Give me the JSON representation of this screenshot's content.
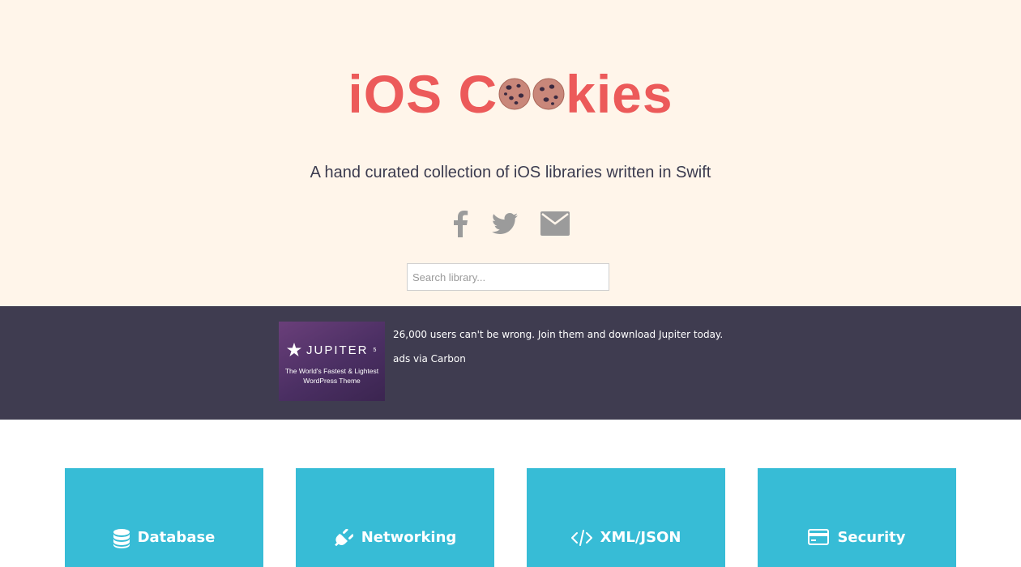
{
  "header": {
    "logo": {
      "part1": "iOS C",
      "part2": "kies"
    },
    "tagline": "A hand curated collection of iOS libraries written in Swift",
    "social": [
      {
        "name": "facebook-icon"
      },
      {
        "name": "twitter-icon"
      },
      {
        "name": "email-icon"
      }
    ],
    "search": {
      "placeholder": "Search library..."
    }
  },
  "ad": {
    "brand": "JUPITER",
    "brand_sup": "5",
    "sub_line1": "The World's Fastest & Lightest",
    "sub_line2": "WordPress Theme",
    "text": "26,000 users can't be wrong. Join them and download Jupiter today.",
    "via": "ads via Carbon"
  },
  "categories": [
    {
      "label": "Database",
      "icon": "database-icon"
    },
    {
      "label": "Networking",
      "icon": "plug-icon"
    },
    {
      "label": "XML/JSON",
      "icon": "code-icon"
    },
    {
      "label": "Security",
      "icon": "credit-card-icon"
    }
  ],
  "colors": {
    "header_bg": "#fff5ea",
    "logo": "#ec5a5a",
    "adbar_bg": "#3f3c50",
    "card_bg": "#37bcd6"
  }
}
